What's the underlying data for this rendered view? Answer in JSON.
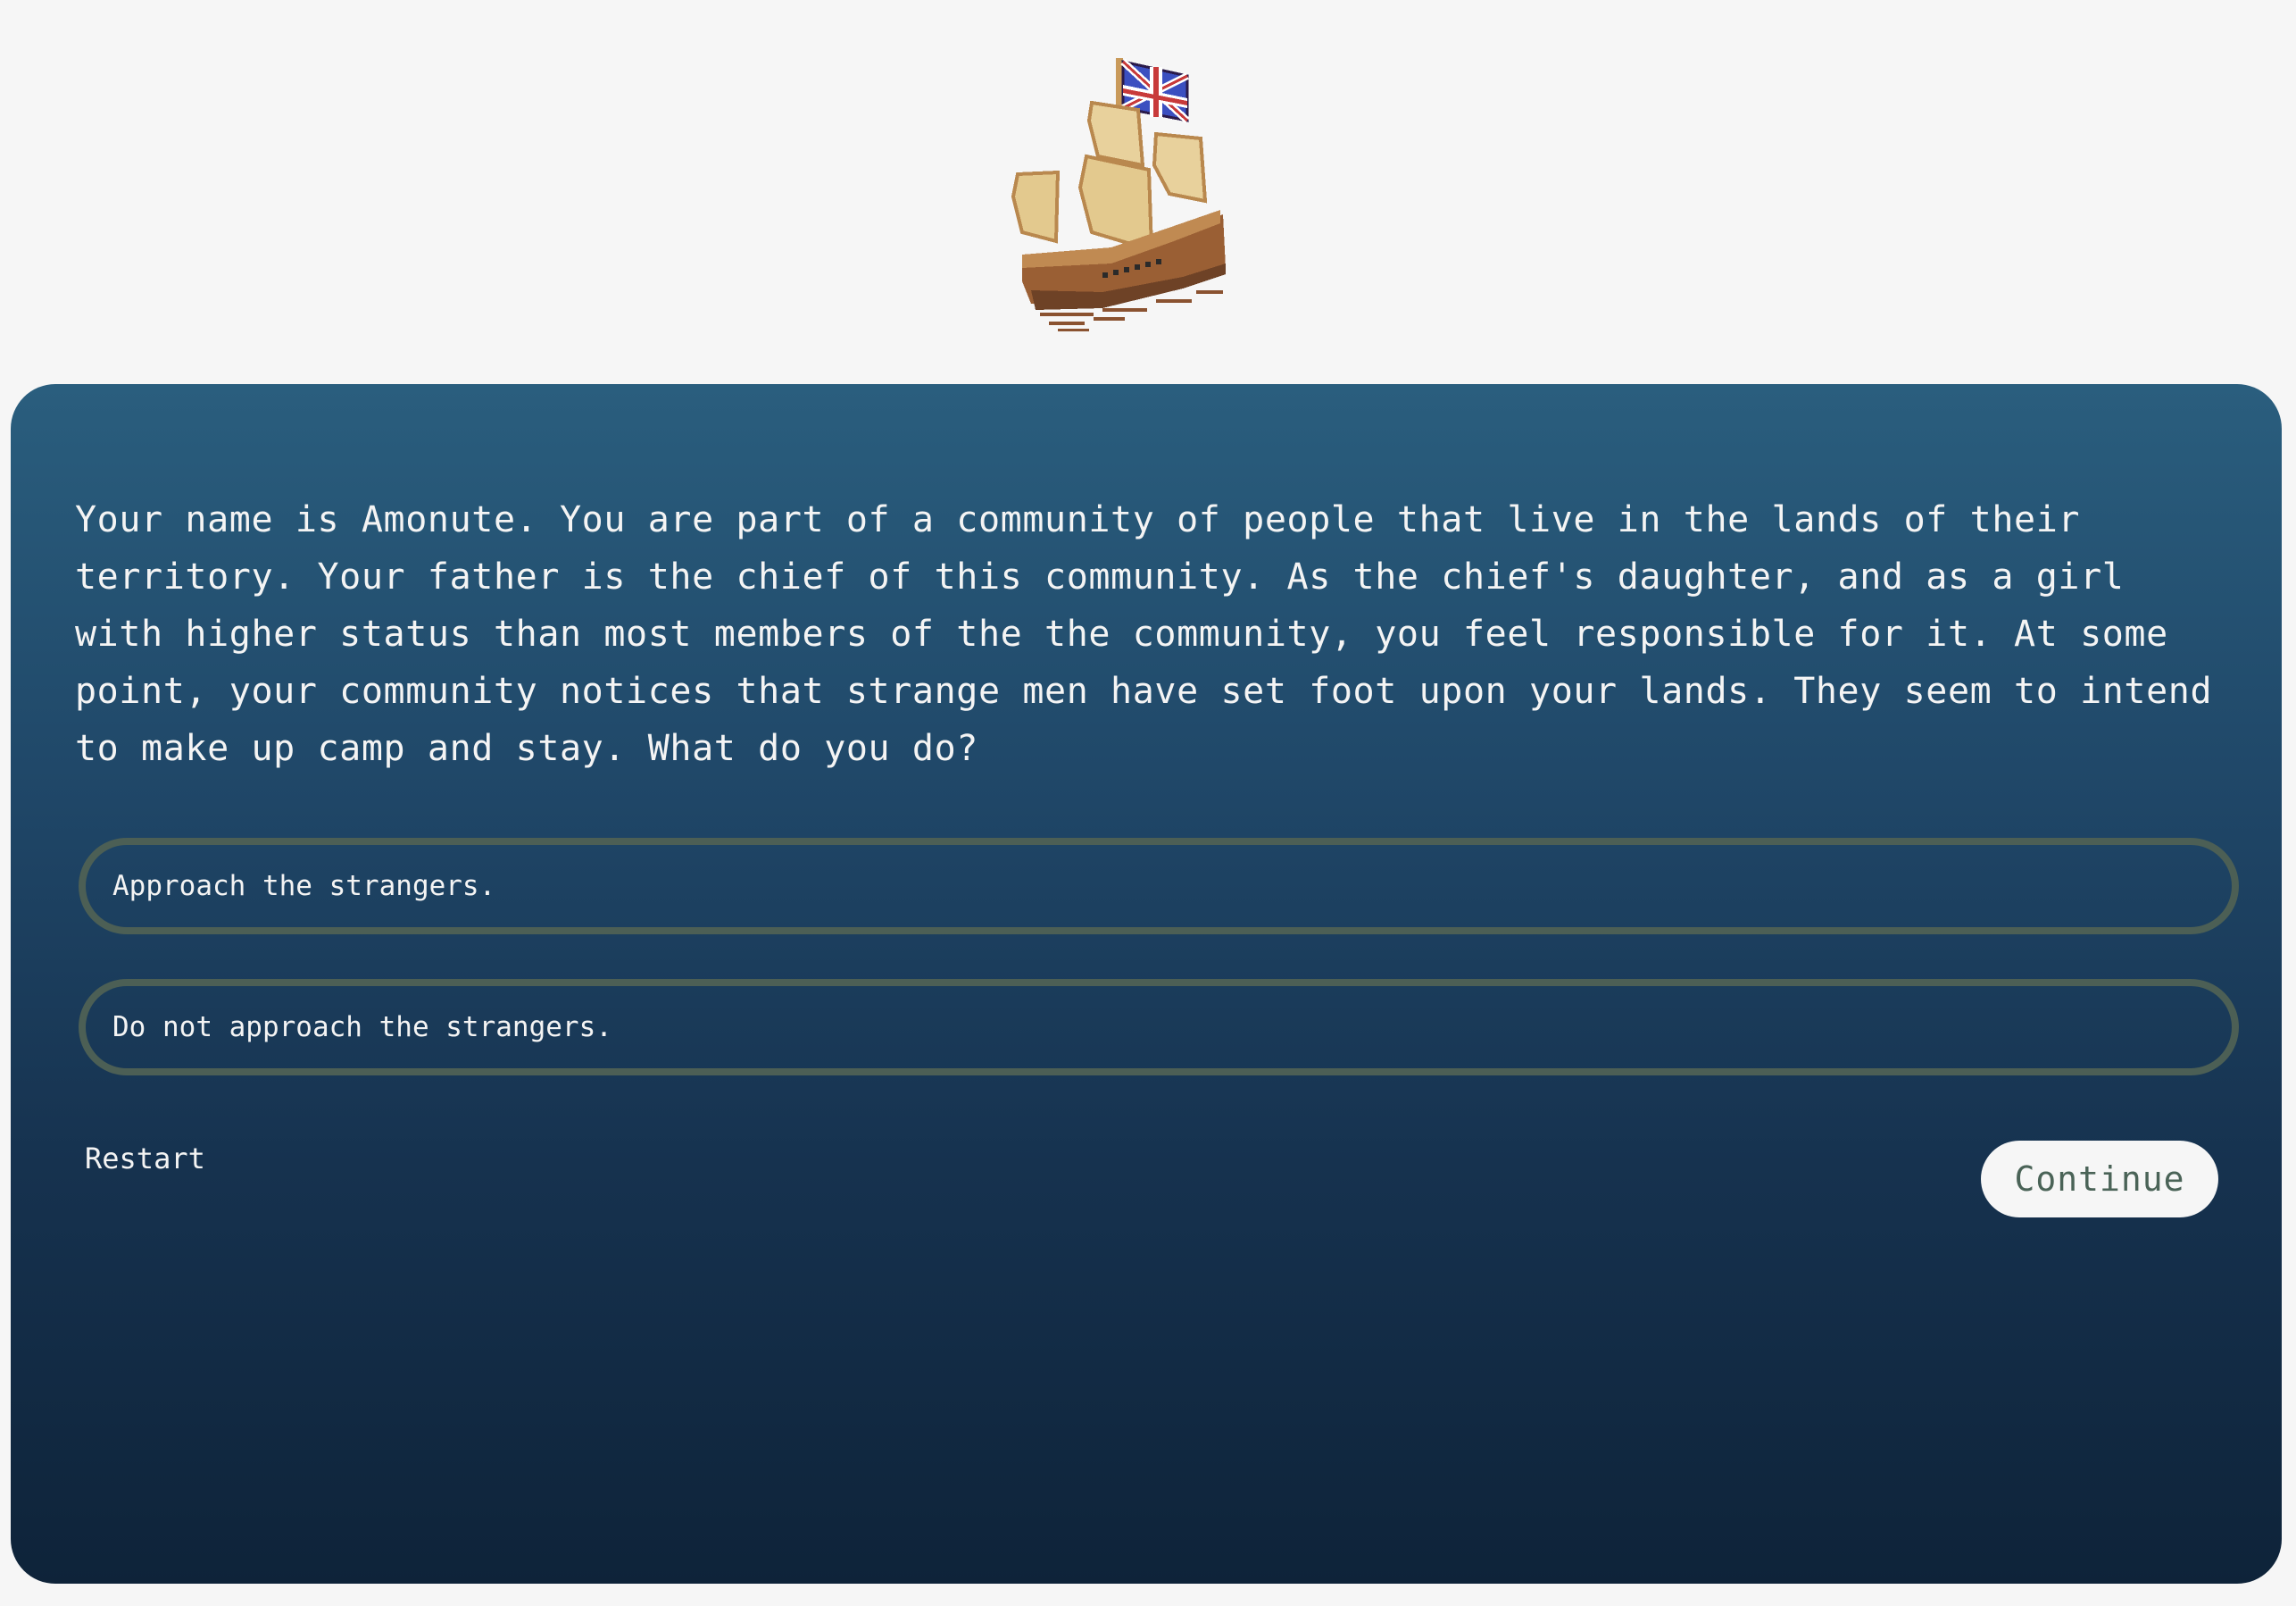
{
  "header": {
    "image": "sailing-ship-with-union-jack-flag"
  },
  "story": {
    "text": "Your name is Amonute. You are part of a community of people that live in the lands of their territory. Your father is the chief of this community. As the chief's daughter, and as a girl with higher status than most members of the the community, you feel responsible for it. At some point, your community notices that strange men have set foot upon your lands. They seem to intend to make up camp and stay. What do you do?"
  },
  "choices": [
    {
      "label": "Approach the strangers."
    },
    {
      "label": "Do not approach the strangers."
    }
  ],
  "controls": {
    "restart_label": "Restart",
    "continue_label": "Continue"
  },
  "colors": {
    "panel_top": "#2a5e7e",
    "panel_bottom": "#0e2339",
    "choice_border": "#4c5f55",
    "continue_text": "#4a6357"
  }
}
